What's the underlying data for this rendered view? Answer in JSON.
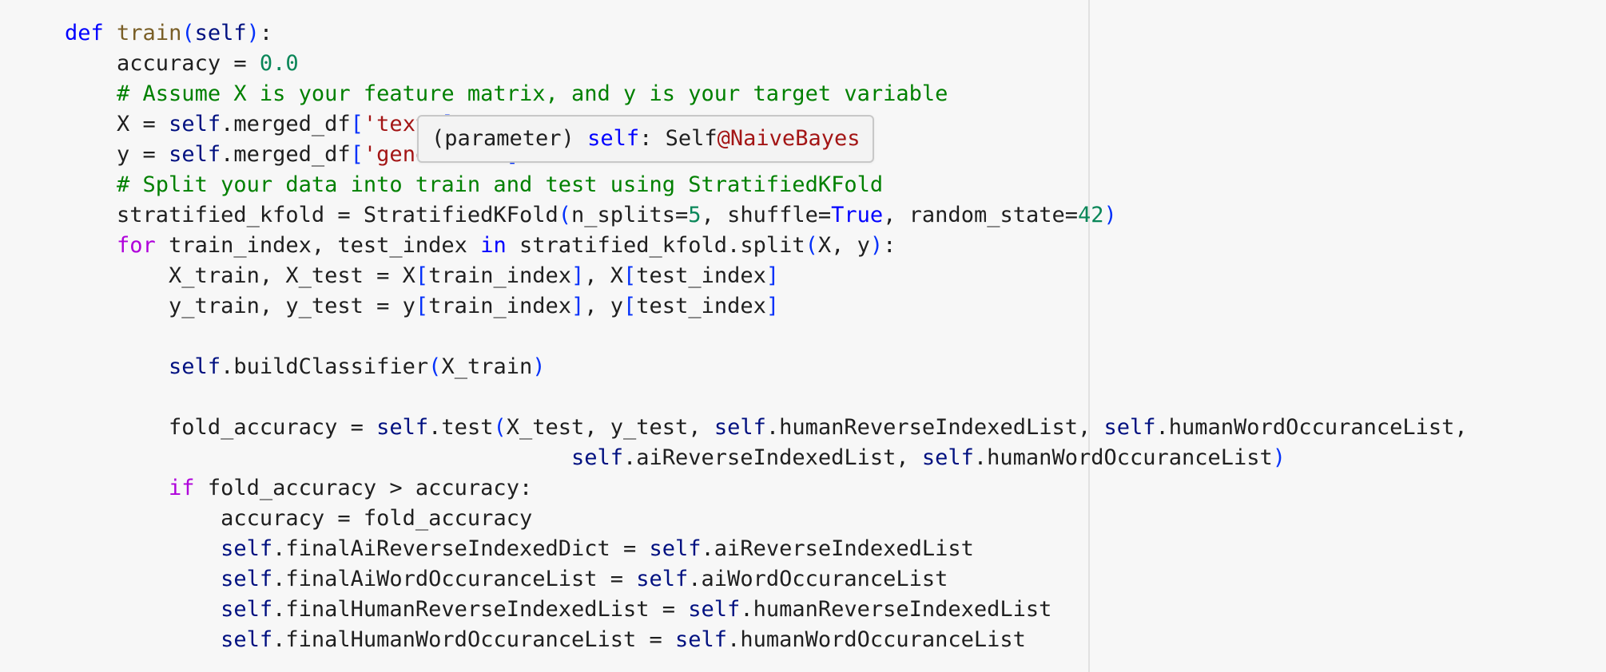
{
  "editor": {
    "language": "python",
    "lines": [
      {
        "indent": 1,
        "tokens": [
          {
            "t": "def",
            "c": "kw-def"
          },
          {
            "t": " "
          },
          {
            "t": "train",
            "c": "fn"
          },
          {
            "t": "(",
            "c": "br1"
          },
          {
            "t": "self",
            "c": "param"
          },
          {
            "t": ")",
            "c": "br1"
          },
          {
            "t": ":"
          }
        ]
      },
      {
        "indent": 2,
        "tokens": [
          {
            "t": "accuracy = "
          },
          {
            "t": "0.0",
            "c": "num"
          }
        ]
      },
      {
        "indent": 2,
        "tokens": [
          {
            "t": "# Assume X is your feature matrix, and y is your target variable",
            "c": "comment"
          }
        ]
      },
      {
        "indent": 2,
        "tokens": [
          {
            "t": "X = "
          },
          {
            "t": "self",
            "c": "self"
          },
          {
            "t": ".merged_df"
          },
          {
            "t": "[",
            "c": "br1"
          },
          {
            "t": "'text'",
            "c": "str"
          },
          {
            "t": "]",
            "c": "br1"
          }
        ]
      },
      {
        "indent": 2,
        "tokens": [
          {
            "t": "y = "
          },
          {
            "t": "self",
            "c": "self"
          },
          {
            "t": ".merged_df"
          },
          {
            "t": "[",
            "c": "br1"
          },
          {
            "t": "'generated'",
            "c": "str"
          },
          {
            "t": "]",
            "c": "br1"
          }
        ]
      },
      {
        "indent": 2,
        "tokens": [
          {
            "t": "# Split your data into train and test using StratifiedKFold",
            "c": "comment"
          }
        ]
      },
      {
        "indent": 2,
        "tokens": [
          {
            "t": "stratified_kfold = StratifiedKFold"
          },
          {
            "t": "(",
            "c": "br1"
          },
          {
            "t": "n_splits="
          },
          {
            "t": "5",
            "c": "num"
          },
          {
            "t": ", shuffle="
          },
          {
            "t": "True",
            "c": "builtin"
          },
          {
            "t": ", random_state="
          },
          {
            "t": "42",
            "c": "num"
          },
          {
            "t": ")",
            "c": "br1"
          }
        ]
      },
      {
        "indent": 2,
        "tokens": [
          {
            "t": "for",
            "c": "kw-flow"
          },
          {
            "t": " train_index, test_index "
          },
          {
            "t": "in",
            "c": "kw-def"
          },
          {
            "t": " stratified_kfold.split"
          },
          {
            "t": "(",
            "c": "br1"
          },
          {
            "t": "X, y"
          },
          {
            "t": ")",
            "c": "br1"
          },
          {
            "t": ":"
          }
        ]
      },
      {
        "indent": 3,
        "tokens": [
          {
            "t": "X_train, X_test = X"
          },
          {
            "t": "[",
            "c": "br1"
          },
          {
            "t": "train_index"
          },
          {
            "t": "]",
            "c": "br1"
          },
          {
            "t": ", X"
          },
          {
            "t": "[",
            "c": "br1"
          },
          {
            "t": "test_index"
          },
          {
            "t": "]",
            "c": "br1"
          }
        ]
      },
      {
        "indent": 3,
        "tokens": [
          {
            "t": "y_train, y_test = y"
          },
          {
            "t": "[",
            "c": "br1"
          },
          {
            "t": "train_index"
          },
          {
            "t": "]",
            "c": "br1"
          },
          {
            "t": ", y"
          },
          {
            "t": "[",
            "c": "br1"
          },
          {
            "t": "test_index"
          },
          {
            "t": "]",
            "c": "br1"
          }
        ]
      },
      {
        "indent": 0,
        "tokens": []
      },
      {
        "indent": 3,
        "tokens": [
          {
            "t": "self",
            "c": "self"
          },
          {
            "t": ".buildClassifier"
          },
          {
            "t": "(",
            "c": "br1"
          },
          {
            "t": "X_train"
          },
          {
            "t": ")",
            "c": "br1"
          }
        ]
      },
      {
        "indent": 0,
        "tokens": []
      },
      {
        "indent": 3,
        "tokens": [
          {
            "t": "fold_accuracy = "
          },
          {
            "t": "self",
            "c": "self"
          },
          {
            "t": ".test"
          },
          {
            "t": "(",
            "c": "br1"
          },
          {
            "t": "X_test, y_test, "
          },
          {
            "t": "self",
            "c": "self"
          },
          {
            "t": ".humanReverseIndexedList, "
          },
          {
            "t": "self",
            "c": "self"
          },
          {
            "t": ".humanWordOccuranceList,"
          }
        ]
      },
      {
        "indent": 0,
        "prefix": "                                       ",
        "tokens": [
          {
            "t": "self",
            "c": "self"
          },
          {
            "t": ".aiReverseIndexedList, "
          },
          {
            "t": "self",
            "c": "self"
          },
          {
            "t": ".humanWordOccuranceList"
          },
          {
            "t": ")",
            "c": "br1"
          }
        ]
      },
      {
        "indent": 3,
        "tokens": [
          {
            "t": "if",
            "c": "kw-flow"
          },
          {
            "t": " fold_accuracy > accuracy:"
          }
        ]
      },
      {
        "indent": 4,
        "tokens": [
          {
            "t": "accuracy = fold_accuracy"
          }
        ]
      },
      {
        "indent": 4,
        "tokens": [
          {
            "t": "self",
            "c": "self"
          },
          {
            "t": ".finalAiReverseIndexedDict = "
          },
          {
            "t": "self",
            "c": "self"
          },
          {
            "t": ".aiReverseIndexedList"
          }
        ]
      },
      {
        "indent": 4,
        "tokens": [
          {
            "t": "self",
            "c": "self"
          },
          {
            "t": ".finalAiWordOccuranceList = "
          },
          {
            "t": "self",
            "c": "self"
          },
          {
            "t": ".aiWordOccuranceList"
          }
        ]
      },
      {
        "indent": 4,
        "tokens": [
          {
            "t": "self",
            "c": "self"
          },
          {
            "t": ".finalHumanReverseIndexedList = "
          },
          {
            "t": "self",
            "c": "self"
          },
          {
            "t": ".humanReverseIndexedList"
          }
        ]
      },
      {
        "indent": 4,
        "tokens": [
          {
            "t": "self",
            "c": "self"
          },
          {
            "t": ".finalHumanWordOccuranceList = "
          },
          {
            "t": "self",
            "c": "self"
          },
          {
            "t": ".humanWordOccuranceList"
          }
        ]
      }
    ]
  },
  "hover_tooltip": {
    "kind": "(parameter)",
    "name": "self",
    "sep": ": ",
    "type_prefix": "Self",
    "type_class": "@NaiveBayes"
  }
}
